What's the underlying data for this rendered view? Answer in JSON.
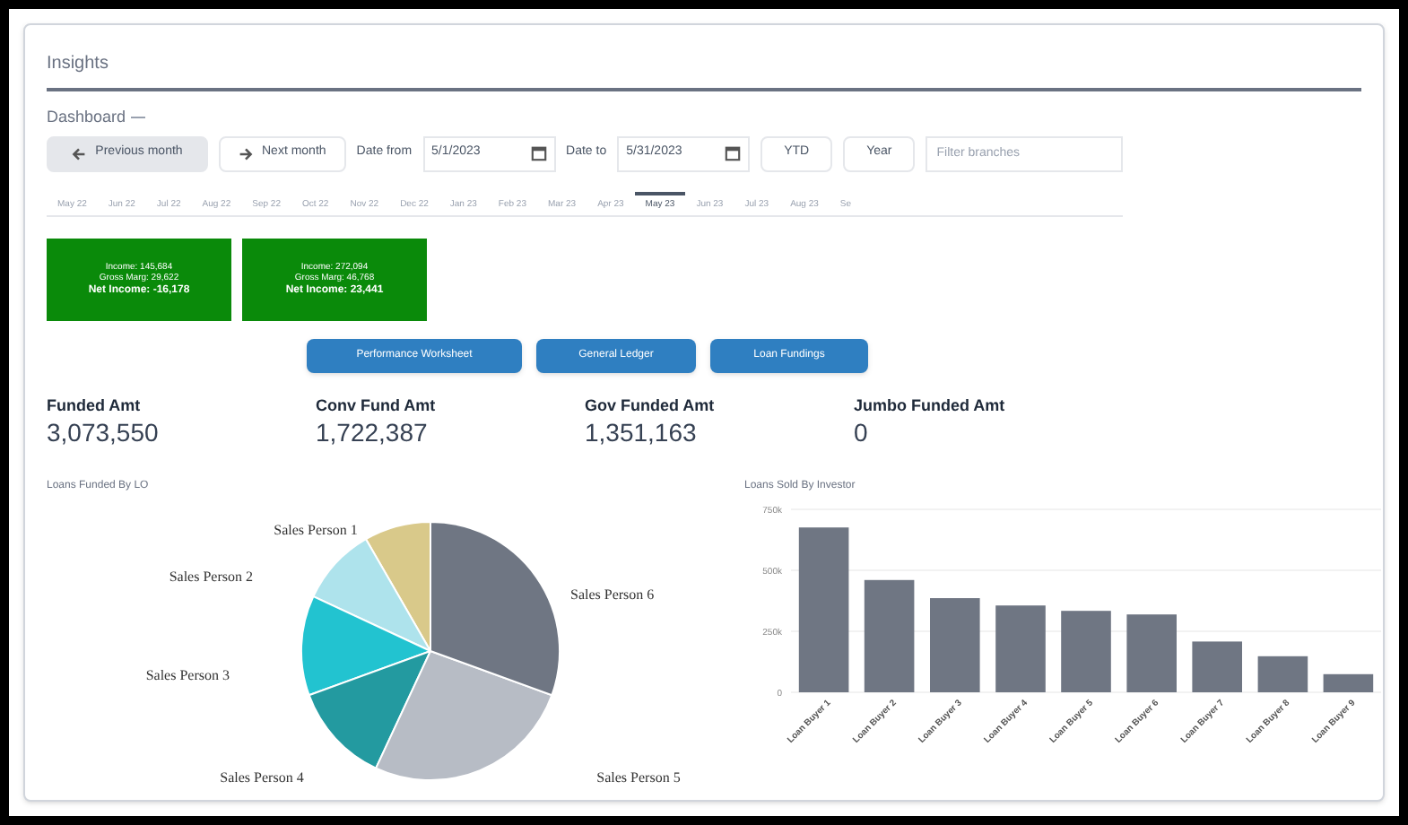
{
  "page": {
    "title": "Insights",
    "section": "Dashboard"
  },
  "toolbar": {
    "previous": {
      "label": "Previous month"
    },
    "next": {
      "label": "Next month"
    },
    "date_from": {
      "label": "Date from",
      "value": "5/1/2023"
    },
    "date_to": {
      "label": "Date to",
      "value": "5/31/2023"
    },
    "buttons": [
      "YTD",
      "Year"
    ],
    "filter": {
      "placeholder": "Filter branches"
    }
  },
  "months": [
    {
      "label": "May 22",
      "selected": false
    },
    {
      "label": "Jun 22",
      "selected": false
    },
    {
      "label": "Jul 22",
      "selected": false
    },
    {
      "label": "Aug 22",
      "selected": false
    },
    {
      "label": "Sep 22",
      "selected": false
    },
    {
      "label": "Oct 22",
      "selected": false
    },
    {
      "label": "Nov 22",
      "selected": false
    },
    {
      "label": "Dec 22",
      "selected": false
    },
    {
      "label": "Jan 23",
      "selected": false
    },
    {
      "label": "Feb 23",
      "selected": false
    },
    {
      "label": "Mar 23",
      "selected": false
    },
    {
      "label": "Apr 23",
      "selected": false
    },
    {
      "label": "May 23",
      "selected": true
    },
    {
      "label": "Jun 23",
      "selected": false
    },
    {
      "label": "Jul 23",
      "selected": false
    },
    {
      "label": "Aug 23",
      "selected": false
    },
    {
      "label": "Se",
      "selected": false
    }
  ],
  "income_cards": [
    {
      "income": "Income: 145,684",
      "gross_margin": "Gross Marg: 29,622",
      "net_income": "Net Income: -16,178"
    },
    {
      "income": "Income: 272,094",
      "gross_margin": "Gross Marg: 46,768",
      "net_income": "Net Income: 23,441"
    }
  ],
  "report_buttons": [
    "Performance Worksheet",
    "General Ledger",
    "Loan Fundings"
  ],
  "stats": [
    {
      "label": "Funded Amt",
      "value": "3,073,550"
    },
    {
      "label": "Conv Fund Amt",
      "value": "1,722,387"
    },
    {
      "label": "Gov Funded Amt",
      "value": "1,351,163"
    },
    {
      "label": "Jumbo Funded Amt",
      "value": "0"
    }
  ],
  "pie_panel": {
    "title": "Loans Funded By LO",
    "slices": [
      {
        "label": "Sales Person 1",
        "color": "#d9c98a"
      },
      {
        "label": "Sales Person 2",
        "color": "#aee3ec"
      },
      {
        "label": "Sales Person 3",
        "color": "#22c3d0"
      },
      {
        "label": "Sales Person 4",
        "color": "#239aa0"
      },
      {
        "label": "Sales Person 5",
        "color": "#b7bcc5"
      },
      {
        "label": "Sales Person 6",
        "color": "#6f7683"
      }
    ]
  },
  "bar_panel": {
    "title": "Loans Sold By Investor",
    "chart_data": {
      "type": "bar",
      "categories": [
        "Loan Buyer 1",
        "Loan Buyer 2",
        "Loan Buyer 3",
        "Loan Buyer 4",
        "Loan Buyer 5",
        "Loan Buyer 6",
        "Loan Buyer 7",
        "Loan Buyer 8",
        "Loan Buyer 9"
      ],
      "series": [
        {
          "color": "#6f7683",
          "values": [
            676000,
            460000,
            386000,
            356000,
            334000,
            319000,
            208000,
            148000,
            74000
          ]
        }
      ],
      "ylim": [
        0,
        750000
      ],
      "yticks": [
        {
          "value": 0,
          "label": "0"
        },
        {
          "value": 250000,
          "label": "250k"
        },
        {
          "value": 500000,
          "label": "500k"
        },
        {
          "value": 750000,
          "label": "750k"
        }
      ]
    }
  }
}
